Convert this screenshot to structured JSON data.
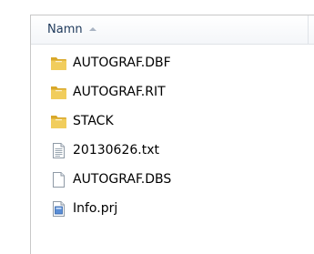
{
  "header": {
    "name_column_label": "Namn"
  },
  "files": [
    {
      "name": "AUTOGRAF.DBF",
      "icon": "folder-icon"
    },
    {
      "name": "AUTOGRAF.RIT",
      "icon": "folder-icon"
    },
    {
      "name": "STACK",
      "icon": "folder-icon"
    },
    {
      "name": "20130626.txt",
      "icon": "text-file-icon"
    },
    {
      "name": "AUTOGRAF.DBS",
      "icon": "blank-file-icon"
    },
    {
      "name": "Info.prj",
      "icon": "project-file-icon"
    }
  ],
  "colors": {
    "header_text": "#1e395b",
    "folder_yellow": "#e9bf3e",
    "border": "#c8c8c8"
  }
}
